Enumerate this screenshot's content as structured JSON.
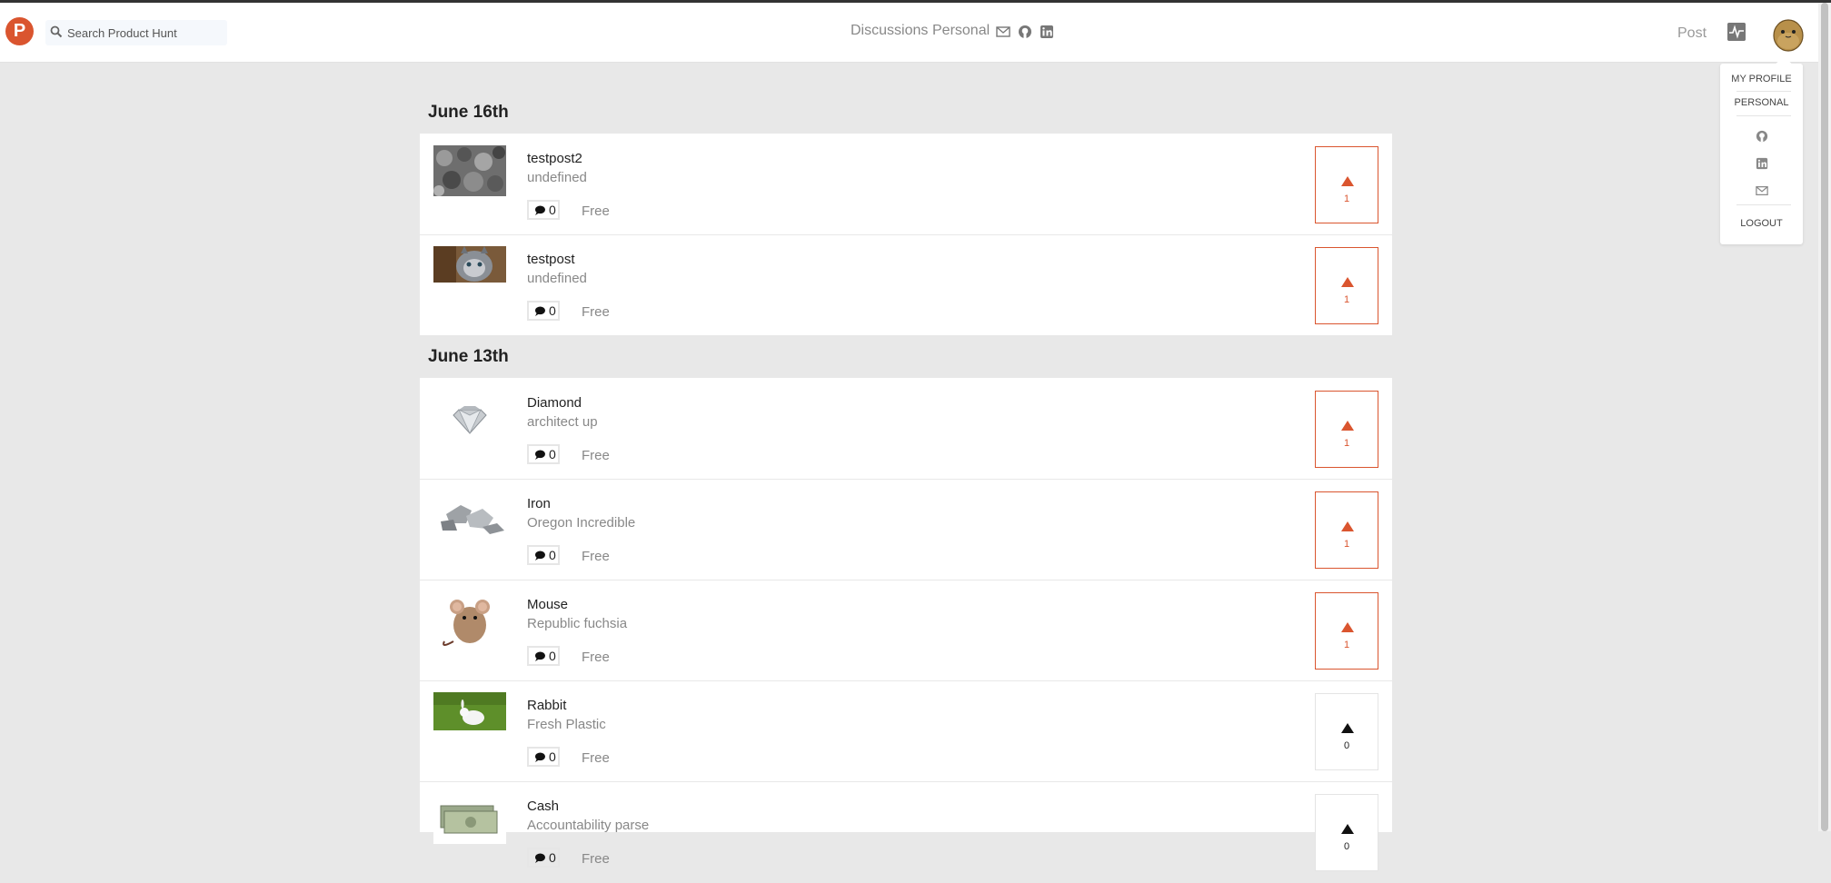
{
  "header": {
    "logo": "P",
    "search_placeholder": "Search Product Hunt",
    "nav": {
      "discussions": "Discussions",
      "personal": "Personal"
    },
    "post": "Post"
  },
  "dropdown": {
    "my_profile": "MY PROFILE",
    "personal": "PERSONAL",
    "logout": "LOGOUT"
  },
  "days": [
    {
      "title": "June 16th",
      "posts": [
        {
          "name": "testpost2",
          "tagline": "undefined",
          "comments": "0",
          "price": "Free",
          "votes": "1",
          "voted": true
        },
        {
          "name": "testpost",
          "tagline": "undefined",
          "comments": "0",
          "price": "Free",
          "votes": "1",
          "voted": true
        }
      ]
    },
    {
      "title": "June 13th",
      "posts": [
        {
          "name": "Diamond",
          "tagline": "architect up",
          "comments": "0",
          "price": "Free",
          "votes": "1",
          "voted": true
        },
        {
          "name": "Iron",
          "tagline": "Oregon Incredible",
          "comments": "0",
          "price": "Free",
          "votes": "1",
          "voted": true
        },
        {
          "name": "Mouse",
          "tagline": "Republic fuchsia",
          "comments": "0",
          "price": "Free",
          "votes": "1",
          "voted": true
        },
        {
          "name": "Rabbit",
          "tagline": "Fresh Plastic",
          "comments": "0",
          "price": "Free",
          "votes": "0",
          "voted": false
        },
        {
          "name": "Cash",
          "tagline": "Accountability parse",
          "comments": "0",
          "price": "Free",
          "votes": "0",
          "voted": false
        }
      ]
    }
  ],
  "colors": {
    "accent": "#da552f",
    "background": "#e8e8e8"
  }
}
